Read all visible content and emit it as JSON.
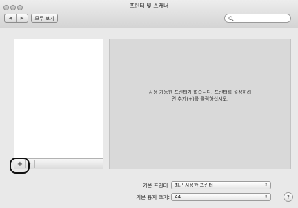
{
  "window": {
    "title": "프린터 및 스캐너"
  },
  "toolbar": {
    "back_icon": "◀",
    "forward_icon": "▶",
    "show_all_label": "모두 보기",
    "search_icon": "search-icon"
  },
  "printer_list": {
    "add_label": "+",
    "remove_label": "-"
  },
  "panel": {
    "empty_message": "사용 가능한 프린터가 없습니다. 프린터를 설정하려면 추가(+)를 클릭하십시오."
  },
  "settings": {
    "default_printer_label": "기본 프린터:",
    "default_printer_value": "최근 사용한 프린터",
    "paper_size_label": "기본 용지 크기:",
    "paper_size_value": "A4"
  },
  "help": {
    "label": "?"
  }
}
